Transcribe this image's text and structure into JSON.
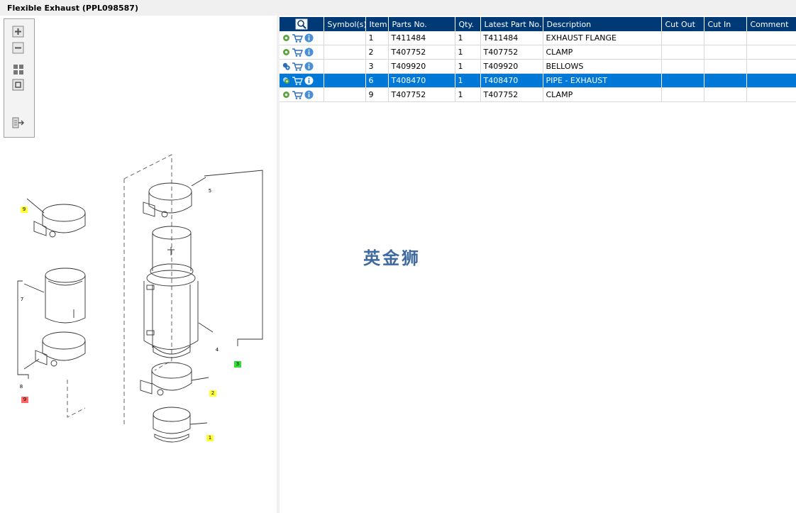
{
  "window": {
    "title": "Flexible Exhaust (PPL098587)"
  },
  "toolbar": {
    "buttons": [
      {
        "name": "zoom-in-button",
        "icon": "zoom-in-icon"
      },
      {
        "name": "zoom-out-button",
        "icon": "zoom-out-icon"
      },
      {
        "name": "fit-all-button",
        "icon": "fit-all-icon"
      },
      {
        "name": "fit-page-button",
        "icon": "fit-page-icon"
      },
      {
        "name": "export-button",
        "icon": "export-icon"
      }
    ]
  },
  "drawing": {
    "callouts": [
      {
        "label": "9",
        "color": "yellow"
      },
      {
        "label": "7",
        "color": "plain"
      },
      {
        "label": "8",
        "color": "plain"
      },
      {
        "label": "9",
        "color": "red"
      },
      {
        "label": "5",
        "color": "plain"
      },
      {
        "label": "4",
        "color": "plain"
      },
      {
        "label": "3",
        "color": "green"
      },
      {
        "label": "2",
        "color": "yellow"
      },
      {
        "label": "1",
        "color": "yellow"
      }
    ]
  },
  "table": {
    "columns": [
      "",
      "Symbol(s)",
      "Item",
      "Parts No.",
      "Qty.",
      "Latest Part No.",
      "Description",
      "Cut Out",
      "Cut In",
      "Comment"
    ],
    "rows": [
      {
        "item": "1",
        "part_no": "T411484",
        "qty": "1",
        "latest": "T411484",
        "description": "EXHAUST FLANGE",
        "status_icon": "gear-icon",
        "selected": false
      },
      {
        "item": "2",
        "part_no": "T407752",
        "qty": "1",
        "latest": "T407752",
        "description": "CLAMP",
        "status_icon": "gear-icon",
        "selected": false
      },
      {
        "item": "3",
        "part_no": "T409920",
        "qty": "1",
        "latest": "T409920",
        "description": "BELLOWS",
        "status_icon": "gears-icon",
        "selected": false
      },
      {
        "item": "6",
        "part_no": "T408470",
        "qty": "1",
        "latest": "T408470",
        "description": "PIPE - EXHAUST",
        "status_icon": "gear-search-icon",
        "selected": true
      },
      {
        "item": "9",
        "part_no": "T407752",
        "qty": "1",
        "latest": "T407752",
        "description": "CLAMP",
        "status_icon": "gear-icon",
        "selected": false
      }
    ]
  },
  "watermark": "英金狮",
  "colors": {
    "header": "#003a76",
    "selected_row": "#0078d7",
    "gear": "#5ba43a",
    "info": "#4a90d9"
  }
}
